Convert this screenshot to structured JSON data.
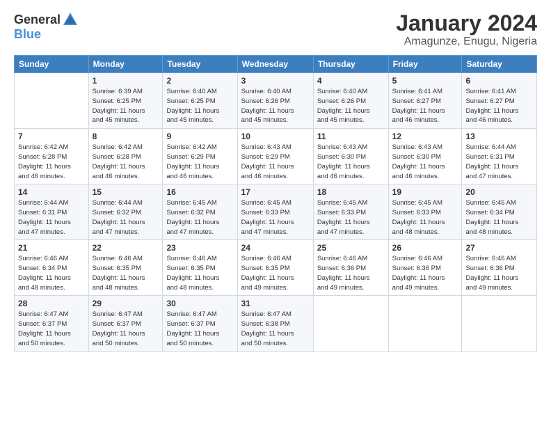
{
  "logo": {
    "general": "General",
    "blue": "Blue"
  },
  "title": "January 2024",
  "subtitle": "Amagunze, Enugu, Nigeria",
  "days_header": [
    "Sunday",
    "Monday",
    "Tuesday",
    "Wednesday",
    "Thursday",
    "Friday",
    "Saturday"
  ],
  "weeks": [
    [
      {
        "num": "",
        "info": ""
      },
      {
        "num": "1",
        "info": "Sunrise: 6:39 AM\nSunset: 6:25 PM\nDaylight: 11 hours\nand 45 minutes."
      },
      {
        "num": "2",
        "info": "Sunrise: 6:40 AM\nSunset: 6:25 PM\nDaylight: 11 hours\nand 45 minutes."
      },
      {
        "num": "3",
        "info": "Sunrise: 6:40 AM\nSunset: 6:26 PM\nDaylight: 11 hours\nand 45 minutes."
      },
      {
        "num": "4",
        "info": "Sunrise: 6:40 AM\nSunset: 6:26 PM\nDaylight: 11 hours\nand 45 minutes."
      },
      {
        "num": "5",
        "info": "Sunrise: 6:41 AM\nSunset: 6:27 PM\nDaylight: 11 hours\nand 46 minutes."
      },
      {
        "num": "6",
        "info": "Sunrise: 6:41 AM\nSunset: 6:27 PM\nDaylight: 11 hours\nand 46 minutes."
      }
    ],
    [
      {
        "num": "7",
        "info": "Sunrise: 6:42 AM\nSunset: 6:28 PM\nDaylight: 11 hours\nand 46 minutes."
      },
      {
        "num": "8",
        "info": "Sunrise: 6:42 AM\nSunset: 6:28 PM\nDaylight: 11 hours\nand 46 minutes."
      },
      {
        "num": "9",
        "info": "Sunrise: 6:42 AM\nSunset: 6:29 PM\nDaylight: 11 hours\nand 46 minutes."
      },
      {
        "num": "10",
        "info": "Sunrise: 6:43 AM\nSunset: 6:29 PM\nDaylight: 11 hours\nand 46 minutes."
      },
      {
        "num": "11",
        "info": "Sunrise: 6:43 AM\nSunset: 6:30 PM\nDaylight: 11 hours\nand 46 minutes."
      },
      {
        "num": "12",
        "info": "Sunrise: 6:43 AM\nSunset: 6:30 PM\nDaylight: 11 hours\nand 46 minutes."
      },
      {
        "num": "13",
        "info": "Sunrise: 6:44 AM\nSunset: 6:31 PM\nDaylight: 11 hours\nand 47 minutes."
      }
    ],
    [
      {
        "num": "14",
        "info": "Sunrise: 6:44 AM\nSunset: 6:31 PM\nDaylight: 11 hours\nand 47 minutes."
      },
      {
        "num": "15",
        "info": "Sunrise: 6:44 AM\nSunset: 6:32 PM\nDaylight: 11 hours\nand 47 minutes."
      },
      {
        "num": "16",
        "info": "Sunrise: 6:45 AM\nSunset: 6:32 PM\nDaylight: 11 hours\nand 47 minutes."
      },
      {
        "num": "17",
        "info": "Sunrise: 6:45 AM\nSunset: 6:33 PM\nDaylight: 11 hours\nand 47 minutes."
      },
      {
        "num": "18",
        "info": "Sunrise: 6:45 AM\nSunset: 6:33 PM\nDaylight: 11 hours\nand 47 minutes."
      },
      {
        "num": "19",
        "info": "Sunrise: 6:45 AM\nSunset: 6:33 PM\nDaylight: 11 hours\nand 48 minutes."
      },
      {
        "num": "20",
        "info": "Sunrise: 6:45 AM\nSunset: 6:34 PM\nDaylight: 11 hours\nand 48 minutes."
      }
    ],
    [
      {
        "num": "21",
        "info": "Sunrise: 6:46 AM\nSunset: 6:34 PM\nDaylight: 11 hours\nand 48 minutes."
      },
      {
        "num": "22",
        "info": "Sunrise: 6:46 AM\nSunset: 6:35 PM\nDaylight: 11 hours\nand 48 minutes."
      },
      {
        "num": "23",
        "info": "Sunrise: 6:46 AM\nSunset: 6:35 PM\nDaylight: 11 hours\nand 48 minutes."
      },
      {
        "num": "24",
        "info": "Sunrise: 6:46 AM\nSunset: 6:35 PM\nDaylight: 11 hours\nand 49 minutes."
      },
      {
        "num": "25",
        "info": "Sunrise: 6:46 AM\nSunset: 6:36 PM\nDaylight: 11 hours\nand 49 minutes."
      },
      {
        "num": "26",
        "info": "Sunrise: 6:46 AM\nSunset: 6:36 PM\nDaylight: 11 hours\nand 49 minutes."
      },
      {
        "num": "27",
        "info": "Sunrise: 6:46 AM\nSunset: 6:36 PM\nDaylight: 11 hours\nand 49 minutes."
      }
    ],
    [
      {
        "num": "28",
        "info": "Sunrise: 6:47 AM\nSunset: 6:37 PM\nDaylight: 11 hours\nand 50 minutes."
      },
      {
        "num": "29",
        "info": "Sunrise: 6:47 AM\nSunset: 6:37 PM\nDaylight: 11 hours\nand 50 minutes."
      },
      {
        "num": "30",
        "info": "Sunrise: 6:47 AM\nSunset: 6:37 PM\nDaylight: 11 hours\nand 50 minutes."
      },
      {
        "num": "31",
        "info": "Sunrise: 6:47 AM\nSunset: 6:38 PM\nDaylight: 11 hours\nand 50 minutes."
      },
      {
        "num": "",
        "info": ""
      },
      {
        "num": "",
        "info": ""
      },
      {
        "num": "",
        "info": ""
      }
    ]
  ]
}
